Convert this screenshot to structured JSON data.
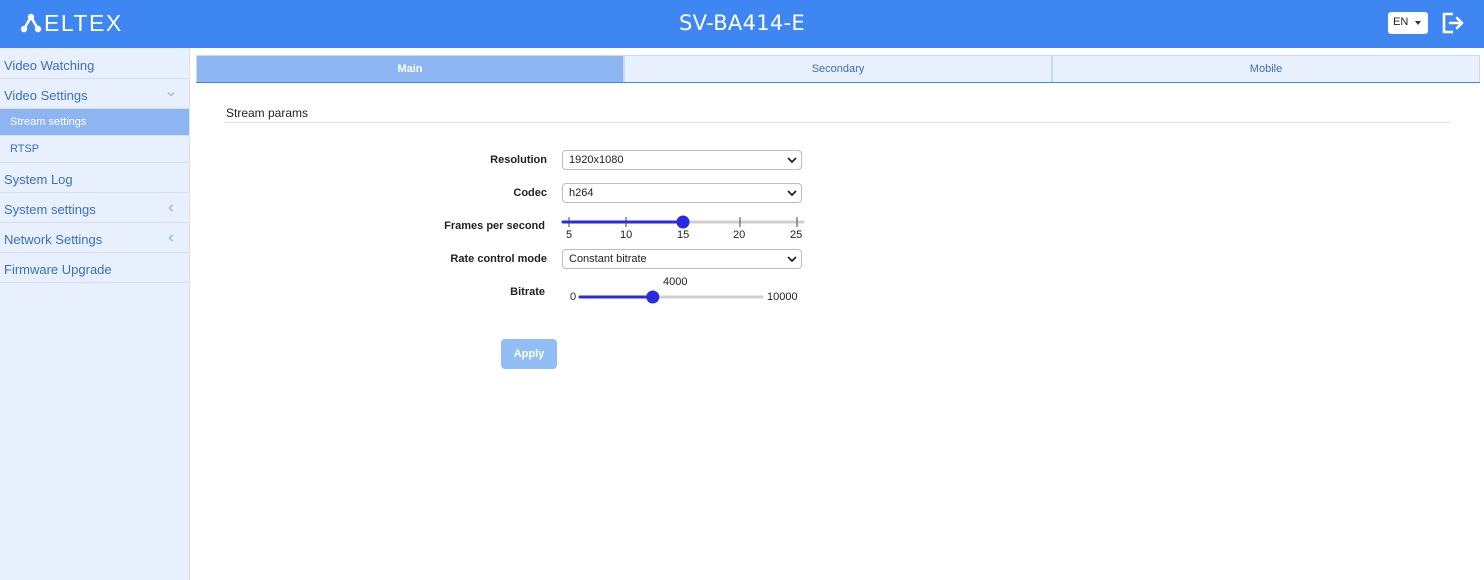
{
  "header": {
    "logo_text": "ELTEX",
    "device_title": "SV-BA414-E",
    "language": "EN",
    "brand_color": "#3e87f2"
  },
  "sidebar": {
    "items": [
      {
        "label": "Video Watching"
      },
      {
        "label": "Video Settings",
        "expanded": true
      },
      {
        "label": "Stream settings",
        "active": true
      },
      {
        "label": "RTSP"
      },
      {
        "label": "System Log"
      },
      {
        "label": "System settings",
        "expanded": false
      },
      {
        "label": "Network Settings",
        "expanded": false
      },
      {
        "label": "Firmware Upgrade"
      }
    ]
  },
  "tabs": [
    {
      "label": "Main",
      "active": true
    },
    {
      "label": "Secondary"
    },
    {
      "label": "Mobile"
    }
  ],
  "form": {
    "section_title": "Stream params",
    "resolution": {
      "label": "Resolution",
      "value": "1920x1080"
    },
    "codec": {
      "label": "Codec",
      "value": "h264"
    },
    "fps": {
      "label": "Frames per second",
      "value": 15,
      "min": 5,
      "max": 25,
      "ticks": [
        "5",
        "10",
        "15",
        "20",
        "25"
      ]
    },
    "rate_control": {
      "label": "Rate control mode",
      "value": "Constant bitrate"
    },
    "bitrate": {
      "label": "Bitrate",
      "value": "4000",
      "min_label": "0",
      "max_label": "10000",
      "min": 0,
      "max": 10000
    },
    "apply_label": "Apply"
  }
}
